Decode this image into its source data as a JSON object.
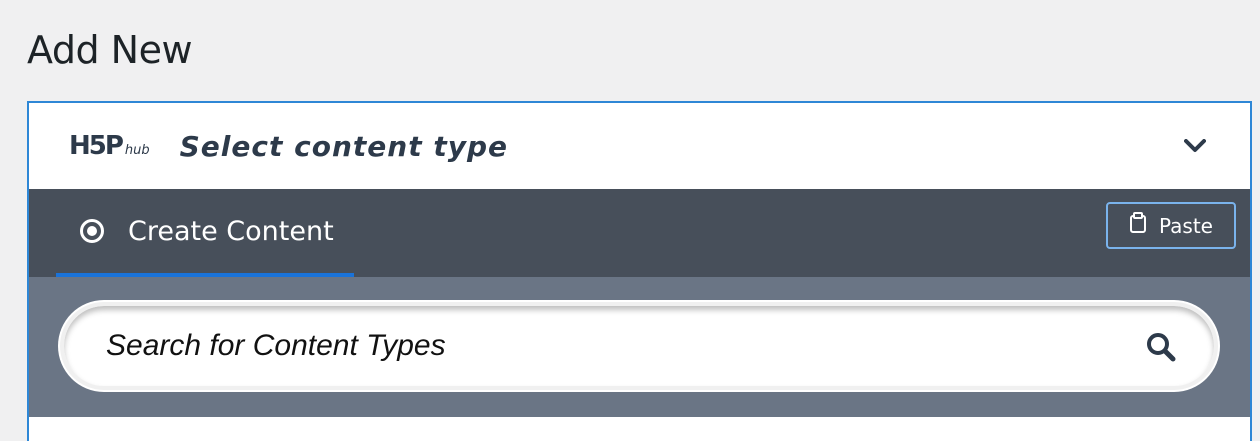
{
  "page": {
    "title": "Add New"
  },
  "hub": {
    "logo_main": "H5P",
    "logo_sub": "hub",
    "title": "Select content type",
    "toggle_icon": "chevron-down-icon"
  },
  "tabs": [
    {
      "label": "Create Content",
      "icon": "radio-selected-icon",
      "selected": true
    }
  ],
  "paste": {
    "label": "Paste",
    "icon": "clipboard-icon"
  },
  "search": {
    "placeholder": "Search for Content Types",
    "icon": "search-icon"
  },
  "colors": {
    "accent": "#2e87d6",
    "tab_bar": "#474f5a",
    "search_bar": "#6a7585",
    "tab_underline": "#1a73d9"
  }
}
